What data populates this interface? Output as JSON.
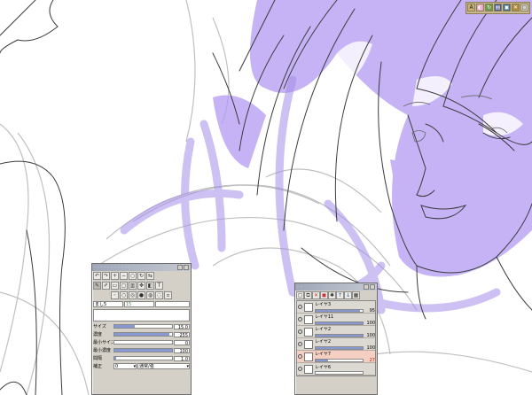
{
  "colors": {
    "sketch_purple": "#b39af3",
    "panel_bg": "#d4d0c8",
    "selected_layer": "#f4cfc2",
    "slider_fill": "#8898d0"
  },
  "top_toolbar": {
    "icons": [
      "text-icon",
      "blend-icon",
      "rotate-icon",
      "layers-icon",
      "save-icon",
      "close-icon",
      "window-icon"
    ],
    "first_label": "A"
  },
  "brush_panel": {
    "name_field": "まし5",
    "name_value": "15",
    "size_label": "サイズ",
    "size_value": "15.0",
    "size_fill": 0.35,
    "opacity_label": "濃度",
    "opacity_value": "255",
    "opacity_fill": 0.95,
    "min_size_label": "最小サイズ",
    "min_size_value": "0",
    "min_size_fill": 0.0,
    "min_opacity_label": "最小濃度",
    "min_opacity_value": "100",
    "min_opacity_fill": 1.0,
    "interval_label": "間隔",
    "interval_value": "1.0",
    "interval_fill": 0.03,
    "correction_label": "補正",
    "correction_value": "0",
    "mode_label": "補正",
    "mode_option": "通常/強"
  },
  "layer_panel": {
    "layers": [
      {
        "name": "レイヤ3",
        "opacity": "95"
      },
      {
        "name": "レイヤ11",
        "opacity": "100"
      },
      {
        "name": "レイヤ2",
        "opacity": "100"
      },
      {
        "name": "レイヤ2",
        "opacity": "100"
      },
      {
        "name": "レイヤ7",
        "opacity": "27"
      },
      {
        "name": "レイヤ6",
        "opacity": ""
      }
    ],
    "opacity_fills": [
      0.95,
      1.0,
      1.0,
      1.0,
      0.27,
      0
    ]
  }
}
